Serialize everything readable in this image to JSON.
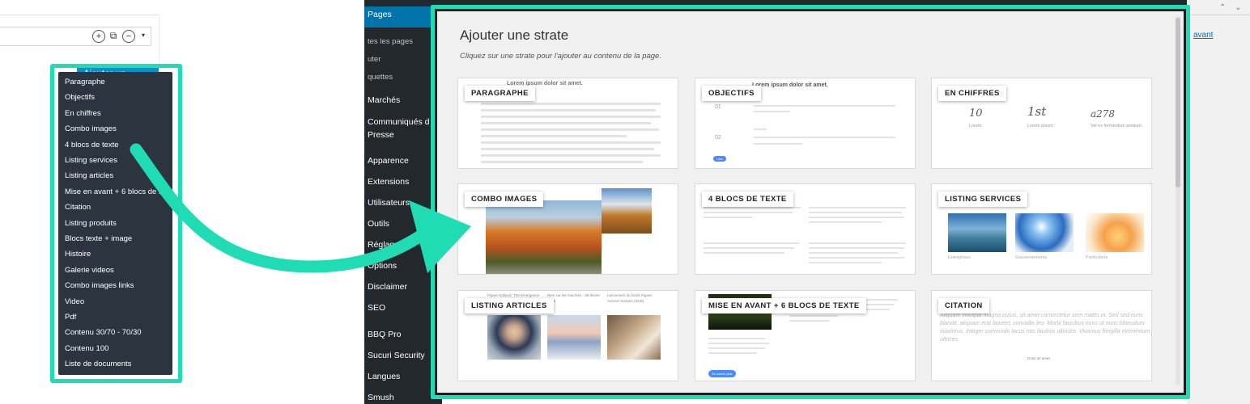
{
  "editor": {
    "toolbar_icons": [
      "plus-icon",
      "copy-icon",
      "minus-icon",
      "caret-down-icon"
    ],
    "add_module_label": "Ajouter un module"
  },
  "module_list": [
    "Paragraphe",
    "Objectifs",
    "En chiffres",
    "Combo images",
    "4 blocs de texte",
    "Listing services",
    "Listing articles",
    "Mise en avant + 6 blocs de t",
    "Citation",
    "Listing produits",
    "Blocs texte + image",
    "Histoire",
    "Galerie videos",
    "Combo images links",
    "Video",
    "Pdf",
    "Contenu 30/70 - 70/30",
    "Contenu 100",
    "Liste de documents"
  ],
  "wp_sidebar": {
    "items": [
      {
        "label": "Pages",
        "type": "active"
      },
      {
        "label": "tes les pages",
        "type": "sub"
      },
      {
        "label": "uter",
        "type": "sub"
      },
      {
        "label": "quettes",
        "type": "sub"
      },
      {
        "label": "Marchés",
        "type": "main"
      },
      {
        "label": "Communiqués d",
        "type": "main"
      },
      {
        "label": "Presse",
        "type": "main"
      },
      {
        "label": "Apparence",
        "type": "main"
      },
      {
        "label": "Extensions",
        "type": "main"
      },
      {
        "label": "Utilisateurs",
        "type": "main"
      },
      {
        "label": "Outils",
        "type": "main"
      },
      {
        "label": "Réglage",
        "type": "main"
      },
      {
        "label": "Options",
        "type": "main"
      },
      {
        "label": "Disclaimer",
        "type": "main"
      },
      {
        "label": "SEO",
        "type": "main"
      },
      {
        "label": "BBQ Pro",
        "type": "main"
      },
      {
        "label": "Sucuri Security",
        "type": "main"
      },
      {
        "label": "Langues",
        "type": "main"
      },
      {
        "label": "Smush",
        "type": "main"
      }
    ]
  },
  "background_right": {
    "link_text": "avant"
  },
  "modal": {
    "title": "Ajouter une strate",
    "subtitle": "Cliquez sur une strate pour l'ajouter au contenu de la page.",
    "cards": [
      {
        "label": "PARAGRAPHE",
        "preview_title": "Lorem ipsum dolor sit amet."
      },
      {
        "label": "OBJECTIFS",
        "preview_title": "Lorem ipsum dolor sit amet.",
        "numbers": [
          "01",
          "02"
        ],
        "button": "Lien"
      },
      {
        "label": "EN CHIFFRES",
        "figures": [
          "10",
          "1st",
          "a278"
        ],
        "captions": [
          "Lorem",
          "Lorem ipsum",
          "Vel ex fermentum pretium."
        ]
      },
      {
        "label": "COMBO IMAGES"
      },
      {
        "label": "4 BLOCS DE TEXTE"
      },
      {
        "label": "LISTING SERVICES",
        "captions": [
          "Entreprises",
          "Gouvernements",
          "Particuliers"
        ]
      },
      {
        "label": "LISTING ARTICLES",
        "captions": [
          "Piguet Galland: The Emergence of",
          "Rien sur les marchés - 28 février 2022",
          "Lancement du fonds Piguet Actions Suisses (SNS)"
        ]
      },
      {
        "label": "MISE EN AVANT + 6 BLOCS DE TEXTE",
        "button": "En savoir plus"
      },
      {
        "label": "CITATION",
        "quote": "Aliquam volutpat magna purus, sit amet consectetur sem mattis in. Sed sed nunc blandit, aliquam erat laoreet, convallis leo. Morbi faucibus nunc ut nunc bibendum maximus. Integer commodo lacus nec facilisis ultricies. Vivamus fringilla elementum ultrices.",
        "author": "Dolor sit amet"
      }
    ]
  },
  "colors": {
    "highlight": "#1fdcb4",
    "dropdown_bg": "#2c3440",
    "button_blue": "#0f8fc8",
    "wp_sidebar": "#23282d"
  }
}
